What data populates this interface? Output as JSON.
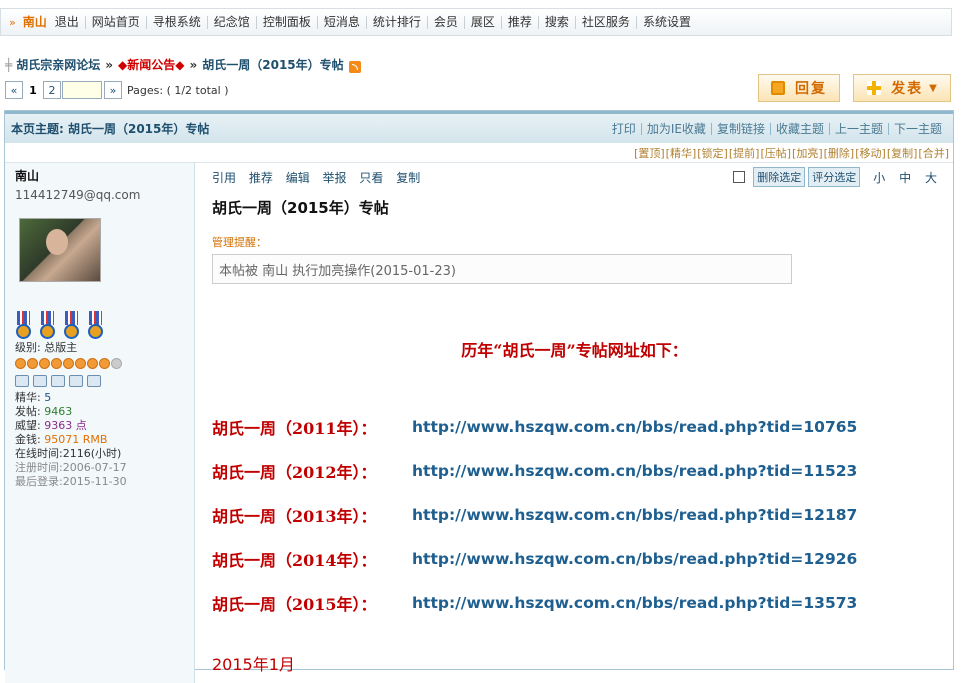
{
  "topnav": {
    "username": "南山",
    "items": [
      "退出",
      "网站首页",
      "寻根系统",
      "纪念馆",
      "控制面板",
      "短消息",
      "统计排行",
      "会员",
      "展区",
      "推荐",
      "搜索",
      "社区服务",
      "系统设置"
    ]
  },
  "breadcrumb": {
    "forum": "胡氏宗亲网论坛",
    "sep": "»",
    "board": "◆新闻公告◆",
    "thread": "胡氏一周（2015年）专帖"
  },
  "pager": {
    "prev": "«",
    "current": "1",
    "page2": "2",
    "next": "»",
    "info": "Pages: ( 1/2 total )"
  },
  "buttons": {
    "reply": "回复",
    "post": "发表"
  },
  "thread_header": {
    "title": "本页主题: 胡氏一周（2015年）专帖",
    "links": [
      "打印",
      "加为IE收藏",
      "复制链接",
      "收藏主题",
      "上一主题",
      "下一主题"
    ]
  },
  "mod_actions": [
    "[置顶]",
    "[精华]",
    "[锁定]",
    "[提前]",
    "[压帖]",
    "[加亮]",
    "[删除]",
    "[移动]",
    "[复制]",
    "[合并]"
  ],
  "author": {
    "name": "南山",
    "email": "114412749@qq.com",
    "level_label": "级别: 总版主",
    "stats": {
      "digest": {
        "label": "精华:",
        "value": "5"
      },
      "posts": {
        "label": "发帖:",
        "value": "9463"
      },
      "prestige": {
        "label": "威望:",
        "value": "9363 点"
      },
      "money": {
        "label": "金钱:",
        "value": "95071 RMB"
      },
      "online": "在线时间:2116(小时)",
      "registered": "注册时间:2006-07-17",
      "last_login": "最后登录:2015-11-30"
    }
  },
  "post": {
    "ops": [
      "引用",
      "推荐",
      "编辑",
      "举报",
      "只看",
      "复制"
    ],
    "delete_sel": "删除选定",
    "rate_sel": "评分选定",
    "font_sizes": [
      "小",
      "中",
      "大"
    ],
    "title": "胡氏一周（2015年）专帖",
    "mgr_label": "管理提醒：",
    "notice": "本帖被 南山 执行加亮操作(2015-01-23)",
    "headline": "历年“胡氏一周”专帖网址如下：",
    "links": [
      {
        "k": "胡氏一周（2011年）：",
        "u": "http://www.hszqw.com.cn/bbs/read.php?tid=10765"
      },
      {
        "k": "胡氏一周（2012年）：",
        "u": "http://www.hszqw.com.cn/bbs/read.php?tid=11523"
      },
      {
        "k": "胡氏一周（2013年）：",
        "u": "http://www.hszqw.com.cn/bbs/read.php?tid=12187"
      },
      {
        "k": "胡氏一周（2014年）：",
        "u": "http://www.hszqw.com.cn/bbs/read.php?tid=12926"
      },
      {
        "k": "胡氏一周（2015年）：",
        "u": "http://www.hszqw.com.cn/bbs/read.php?tid=13573"
      }
    ],
    "month": "2015年1月"
  }
}
